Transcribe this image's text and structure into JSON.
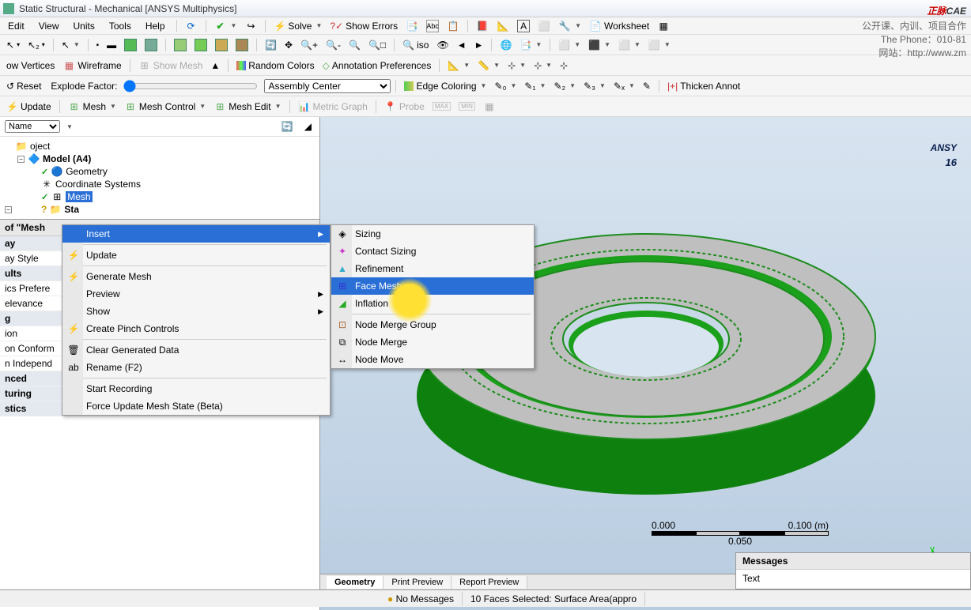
{
  "title": "Static Structural - Mechanical [ANSYS Multiphysics]",
  "menubar": [
    "Edit",
    "View",
    "Units",
    "Tools",
    "Help"
  ],
  "menubar_buttons": {
    "solve": "Solve",
    "show_errors": "Show Errors",
    "worksheet": "Worksheet"
  },
  "toolbar3": {
    "show_vertices": "ow Vertices",
    "wireframe": "Wireframe",
    "show_mesh": "Show Mesh",
    "random_colors": "Random Colors",
    "annotation_prefs": "Annotation Preferences"
  },
  "toolbar4": {
    "reset": "Reset",
    "explode_factor": "Explode Factor:",
    "assembly_center": "Assembly Center",
    "edge_coloring": "Edge Coloring",
    "thicken": "Thicken Annot"
  },
  "toolbar5": {
    "update": "Update",
    "mesh": "Mesh",
    "mesh_control": "Mesh Control",
    "mesh_edit": "Mesh Edit",
    "metric_graph": "Metric Graph",
    "probe": "Probe"
  },
  "outline": {
    "filter_label": "Name",
    "project": "oject",
    "model": "Model (A4)",
    "geometry": "Geometry",
    "coord_systems": "Coordinate Systems",
    "mesh": "Mesh",
    "static": "Sta"
  },
  "details": {
    "header": "of \"Mesh",
    "rows": [
      "ay",
      "ay Style",
      "ults",
      "ics Prefere",
      "elevance",
      "g",
      "ion",
      "on Conform",
      "n Independ",
      "nced",
      "turing",
      "stics"
    ]
  },
  "context_menu": {
    "insert": "Insert",
    "update": "Update",
    "generate_mesh": "Generate Mesh",
    "preview": "Preview",
    "show": "Show",
    "create_pinch": "Create Pinch Controls",
    "clear_data": "Clear Generated Data",
    "rename": "Rename (F2)",
    "start_recording": "Start Recording",
    "force_update": "Force Update Mesh State (Beta)"
  },
  "submenu": {
    "sizing": "Sizing",
    "contact_sizing": "Contact Sizing",
    "refinement": "Refinement",
    "face_meshing": "Face Meshing",
    "inflation": "Inflation",
    "node_merge_group": "Node Merge Group",
    "node_merge": "Node Merge",
    "node_move": "Node Move"
  },
  "viewport": {
    "ansys": "ANSY",
    "ansys_ver": "16",
    "scale_start": "0.000",
    "scale_mid": "0.050",
    "scale_end": "0.100 (m)"
  },
  "bottom_tabs": [
    "Geometry",
    "Print Preview",
    "Report Preview"
  ],
  "statusbar": {
    "no_messages": "No Messages",
    "selection": "10 Faces Selected: Surface Area(appro"
  },
  "messages": {
    "header": "Messages",
    "text_col": "Text"
  },
  "watermark": {
    "brand": "正脉",
    "brand2": "CAE",
    "line1": "公开课、内训、项目合作",
    "phone": "The Phone：010-81",
    "site": "网站：http://www.zm"
  }
}
